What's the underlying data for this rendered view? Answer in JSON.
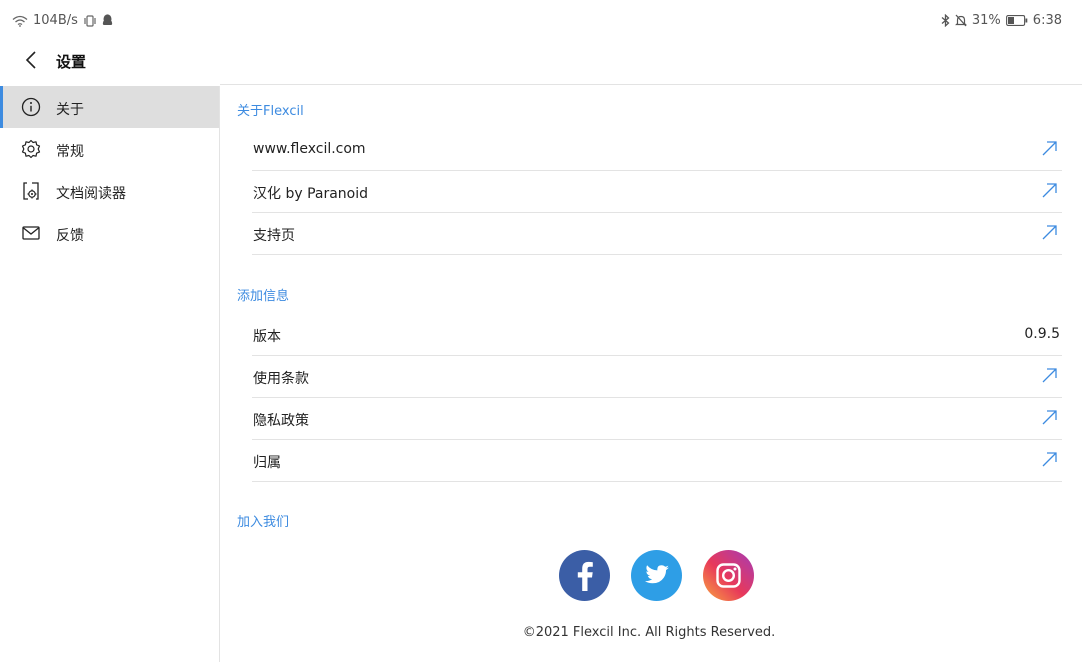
{
  "status_bar": {
    "network_speed": "104B/s",
    "battery_percent": "31%",
    "time": "6:38",
    "icons_left": [
      "wifi-icon",
      "vibrate-icon",
      "qq-notification-icon"
    ],
    "icons_right": [
      "bluetooth-icon",
      "mute-icon",
      "battery-icon"
    ]
  },
  "header": {
    "title": "设置",
    "back_icon": "chevron-left-icon"
  },
  "sidebar": {
    "accent_color": "#3d8be0",
    "active_background": "#dedede",
    "items": [
      {
        "label": "关于",
        "icon": "info-icon",
        "active": true
      },
      {
        "label": "常规",
        "icon": "gear-icon",
        "active": false
      },
      {
        "label": "文档阅读器",
        "icon": "document-settings-icon",
        "active": false
      },
      {
        "label": "反馈",
        "icon": "mail-icon",
        "active": false
      }
    ]
  },
  "main": {
    "accent_color": "#3d8be0",
    "sections": [
      {
        "title": "关于Flexcil",
        "rows": [
          {
            "label": "www.flexcil.com",
            "action": "external-link-icon"
          },
          {
            "label": "汉化 by Paranoid",
            "action": "external-link-icon"
          },
          {
            "label": "支持页",
            "action": "external-link-icon"
          }
        ]
      },
      {
        "title": "添加信息",
        "rows": [
          {
            "label": "版本",
            "value": "0.9.5"
          },
          {
            "label": "使用条款",
            "action": "external-link-icon"
          },
          {
            "label": "隐私政策",
            "action": "external-link-icon"
          },
          {
            "label": "归属",
            "action": "external-link-icon"
          }
        ]
      },
      {
        "title": "加入我们",
        "social": [
          {
            "name": "facebook-icon",
            "color": "#3b5ea6"
          },
          {
            "name": "twitter-icon",
            "color": "#2e9ee6"
          },
          {
            "name": "instagram-icon",
            "color": "#e1306c"
          }
        ]
      }
    ],
    "copyright": "©2021 Flexcil Inc. All Rights Reserved."
  }
}
